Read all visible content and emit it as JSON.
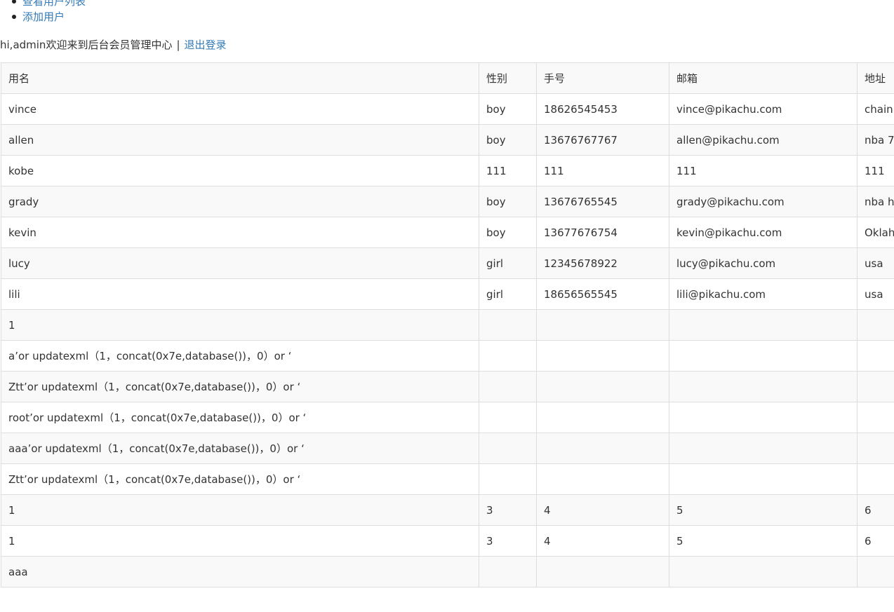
{
  "nav": {
    "links": [
      "查看用户列表",
      "添加用户"
    ]
  },
  "greeting": {
    "text": "hi,admin欢迎来到后台会员管理中心",
    "separator": "|",
    "logout_label": "退出登录"
  },
  "table": {
    "columns": [
      "用名",
      "性别",
      "手号",
      "邮箱",
      "地址"
    ],
    "rows": [
      [
        "vince",
        "boy",
        "18626545453",
        "vince@pikachu.com",
        "chain"
      ],
      [
        "allen",
        "boy",
        "13676767767",
        "allen@pikachu.com",
        "nba 7"
      ],
      [
        "kobe",
        "111",
        "111",
        "111",
        "111"
      ],
      [
        "grady",
        "boy",
        "13676765545",
        "grady@pikachu.com",
        "nba h"
      ],
      [
        "kevin",
        "boy",
        "13677676754",
        "kevin@pikachu.com",
        "Oklah"
      ],
      [
        "lucy",
        "girl",
        "12345678922",
        "lucy@pikachu.com",
        "usa"
      ],
      [
        "lili",
        "girl",
        "18656565545",
        "lili@pikachu.com",
        "usa"
      ],
      [
        "1",
        "",
        "",
        "",
        ""
      ],
      [
        "a’or updatexml（1，concat(0x7e,database())，0）or ‘",
        "",
        "",
        "",
        ""
      ],
      [
        "Ztt’or updatexml（1，concat(0x7e,database())，0）or ‘",
        "",
        "",
        "",
        ""
      ],
      [
        "root’or updatexml（1，concat(0x7e,database())，0）or ‘",
        "",
        "",
        "",
        ""
      ],
      [
        "aaa’or updatexml（1，concat(0x7e,database())，0）or ‘",
        "",
        "",
        "",
        ""
      ],
      [
        "Ztt’or updatexml（1，concat(0x7e,database())，0）or ‘",
        "",
        "",
        "",
        ""
      ],
      [
        "1",
        "3",
        "4",
        "5",
        "6"
      ],
      [
        "1",
        "3",
        "4",
        "5",
        "6"
      ],
      [
        "aaa",
        "",
        "",
        "",
        ""
      ]
    ]
  }
}
